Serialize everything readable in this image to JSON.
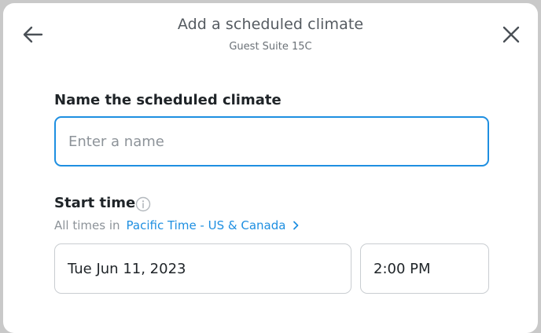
{
  "header": {
    "title": "Add a scheduled climate",
    "subtitle": "Guest Suite 15C",
    "back_icon": "arrow-left-icon",
    "close_icon": "close-icon"
  },
  "form": {
    "name_label": "Name the scheduled climate",
    "name_value": "",
    "name_placeholder": "Enter a name",
    "start_label": "Start time",
    "info_icon": "info-icon",
    "timezone_prefix": "All times in",
    "timezone_link": "Pacific Time - US & Canada",
    "date_value": "Tue Jun 11, 2023",
    "time_value": "2:00 PM"
  },
  "colors": {
    "accent": "#1e8fe1",
    "label": "#1f2428",
    "muted": "#8d9399",
    "border": "#c9cdd1"
  }
}
